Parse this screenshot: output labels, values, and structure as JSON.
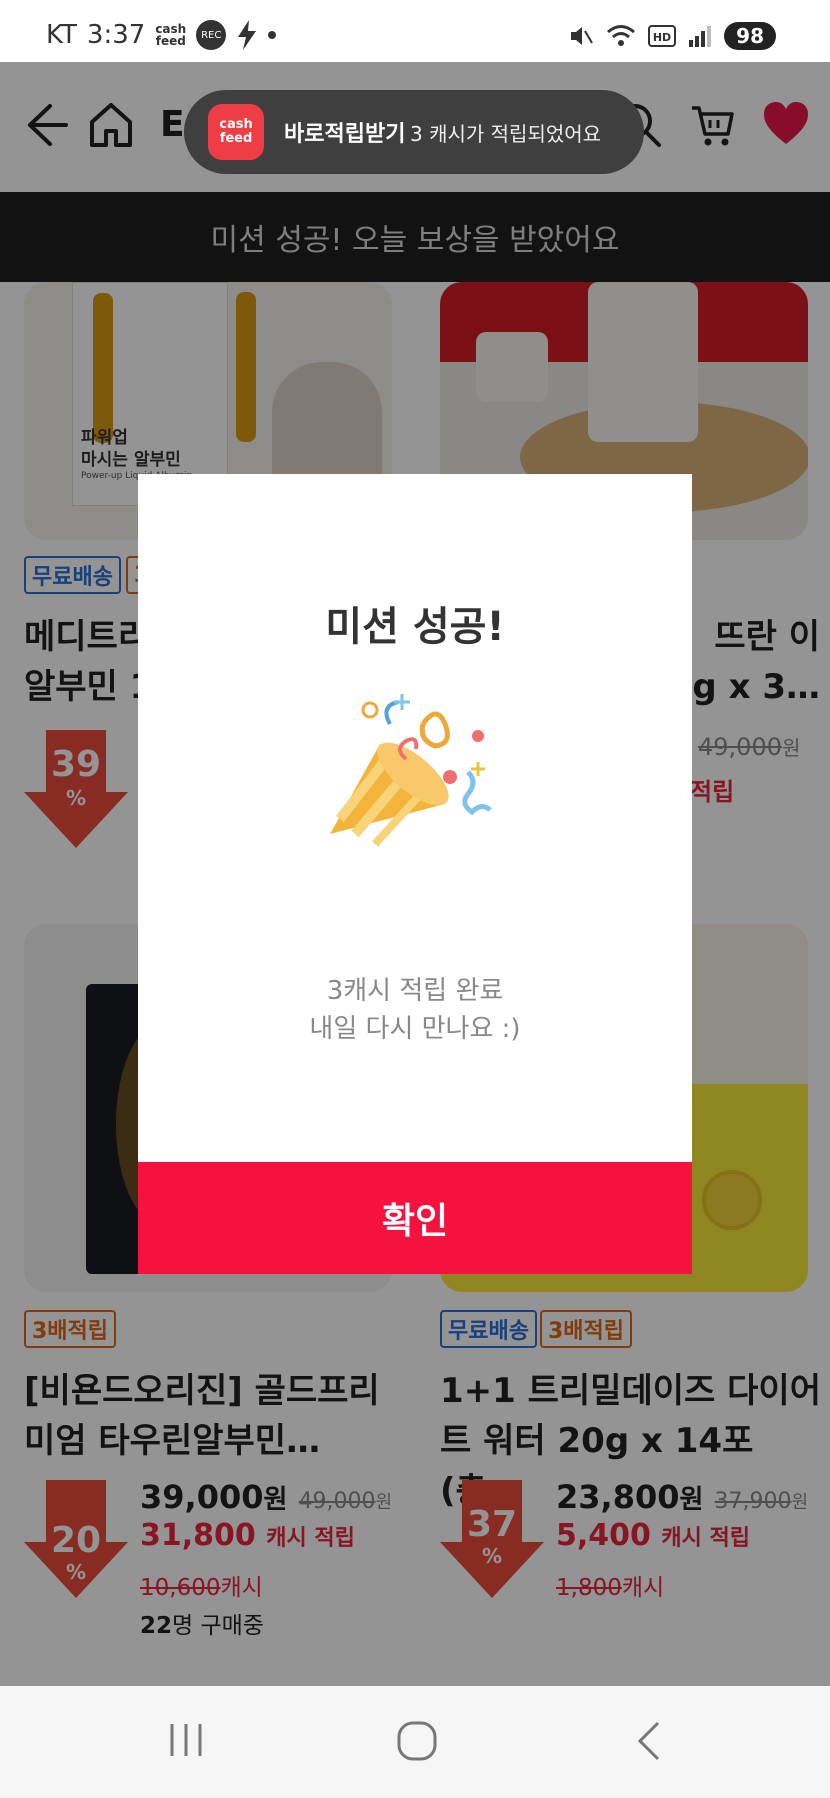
{
  "status_bar": {
    "carrier": "KT",
    "time": "3:37",
    "cashfeed_small": [
      "cash",
      "feed"
    ],
    "rec_label": "REC",
    "battery": "98"
  },
  "header": {
    "title": "E",
    "icons": [
      "back-icon",
      "home-icon",
      "search-icon",
      "cart-icon",
      "heart-icon"
    ]
  },
  "mission_banner": "미션 성공! 오늘 보상을 받았어요",
  "toast": {
    "logo_line1": "cash",
    "logo_line2": "feed",
    "title": "바로적립받기",
    "message": "3 캐시가 적립되었어요"
  },
  "products_top": {
    "left": {
      "badges": [
        "무료배송",
        "3"
      ],
      "name_line1": "메디트리",
      "name_line2": "알부민 1",
      "discount": "39",
      "pct": "%",
      "img_text1": "파워업",
      "img_text2": "마시는 알부민",
      "img_text3": "Power-up Liquid Albumin"
    },
    "right": {
      "name_line1": "뜨란 이",
      "name_line2": "g x 3…",
      "orig_price": "49,000",
      "orig_unit": "원",
      "cash_partial": "적립"
    }
  },
  "products_bottom": [
    {
      "badges": [
        "3배적립"
      ],
      "name_line1": "[비욘드오리진] 골드프리",
      "name_line2": "미엄 타우린알부민…",
      "price": "39,000",
      "price_unit": "원",
      "orig_price": "49,000",
      "orig_unit": "원",
      "cash": "31,800",
      "cash_label": "캐시 적립",
      "cash_old": "10,600",
      "cash_old_unit": "캐시",
      "buyers_count": "22",
      "buyers_label": "명 구매중",
      "discount": "20",
      "pct": "%"
    },
    {
      "badges": [
        "무료배송",
        "3배적립"
      ],
      "name_line1": "1+1 트리밀데이즈 다이어",
      "name_line2": "트 워터 20g x 14포 (총…",
      "price": "23,800",
      "price_unit": "원",
      "orig_price": "37,900",
      "orig_unit": "원",
      "cash": "5,400",
      "cash_label": "캐시 적립",
      "cash_old": "1,800",
      "cash_old_unit": "캐시",
      "discount": "37",
      "pct": "%"
    }
  ],
  "modal": {
    "title": "미션 성공!",
    "line1": "3캐시 적립 완료",
    "line2": "내일 다시 만나요 :)",
    "confirm": "확인",
    "illustration": "party-popper-icon"
  },
  "nav": [
    "recent-apps-icon",
    "home-circle-icon",
    "back-chevron-icon"
  ],
  "colors": {
    "accent": "#f5123f",
    "cash_red": "#e8253e",
    "badge_blue": "#2a6fd6",
    "badge_orange": "#e0651a",
    "banner_dark": "#1f1f1f"
  }
}
